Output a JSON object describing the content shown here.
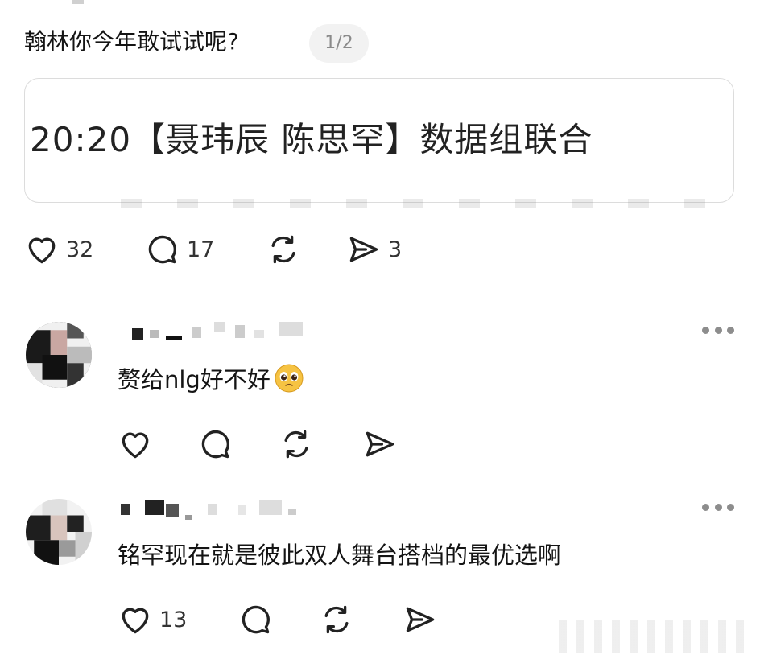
{
  "post": {
    "title": "翰林你今年敢试试呢?",
    "page_indicator": "1/2",
    "link_card_text": "20:20【聂玮辰 陈思罕】数据组联合",
    "actions": {
      "likes": "32",
      "comments": "17",
      "shares": "3"
    }
  },
  "comments": [
    {
      "text": "赘给nlg好不好",
      "emoji": "pleading-face-emoji",
      "likes": ""
    },
    {
      "text": "铭罕现在就是彼此双人舞台搭档的最优选啊",
      "likes": "13"
    }
  ],
  "icons": {
    "like": "heart-icon",
    "comment": "speech-bubble-icon",
    "repost": "repost-arrows-icon",
    "share": "paper-plane-icon",
    "more": "more-dots-icon"
  },
  "colors": {
    "text": "#141414",
    "icon": "#222222",
    "muted": "#8a8a8a",
    "badge_bg": "#f2f2f2",
    "card_border": "#dcdcdc"
  }
}
